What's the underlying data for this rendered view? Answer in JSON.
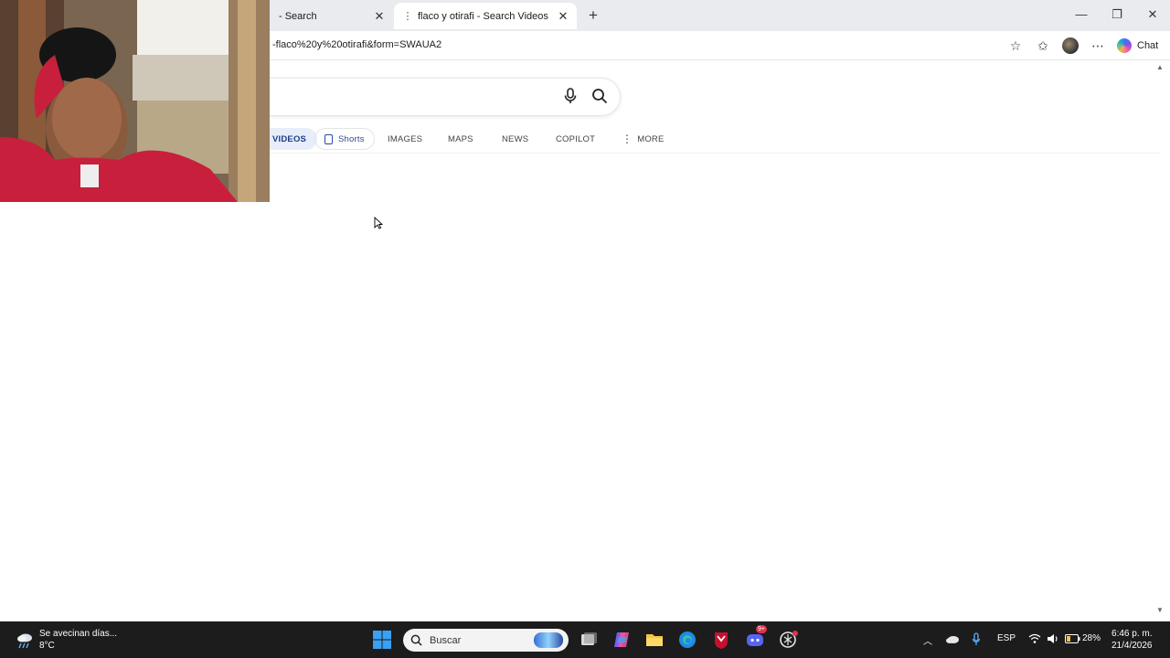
{
  "browser": {
    "tabs": [
      {
        "title": "- Search",
        "active": false
      },
      {
        "title": "flaco y otirafi - Search Videos",
        "active": true
      }
    ],
    "address": "-flaco%20y%20otirafi&form=SWAUA2",
    "chat_label": "Chat"
  },
  "search": {
    "verticals": [
      {
        "label": "VIDEOS",
        "selected": true
      },
      {
        "label": "Shorts",
        "selected": false
      },
      {
        "label": "IMAGES",
        "selected": false
      },
      {
        "label": "MAPS",
        "selected": false
      },
      {
        "label": "NEWS",
        "selected": false
      },
      {
        "label": "COPILOT",
        "selected": false
      },
      {
        "label": "MORE",
        "selected": false
      }
    ]
  },
  "taskbar": {
    "weather_text": "Se avecinan días...",
    "weather_temp": "8°C",
    "search_placeholder": "Buscar",
    "language": "ESP",
    "battery": "28%",
    "time": "6:46 p. m.",
    "date": "21/4/2026",
    "discord_badge": "9+"
  },
  "colors": {
    "accent": "#1b3d8f",
    "taskbar": "#1c1c1c",
    "tabstrip": "#e9ebee"
  }
}
